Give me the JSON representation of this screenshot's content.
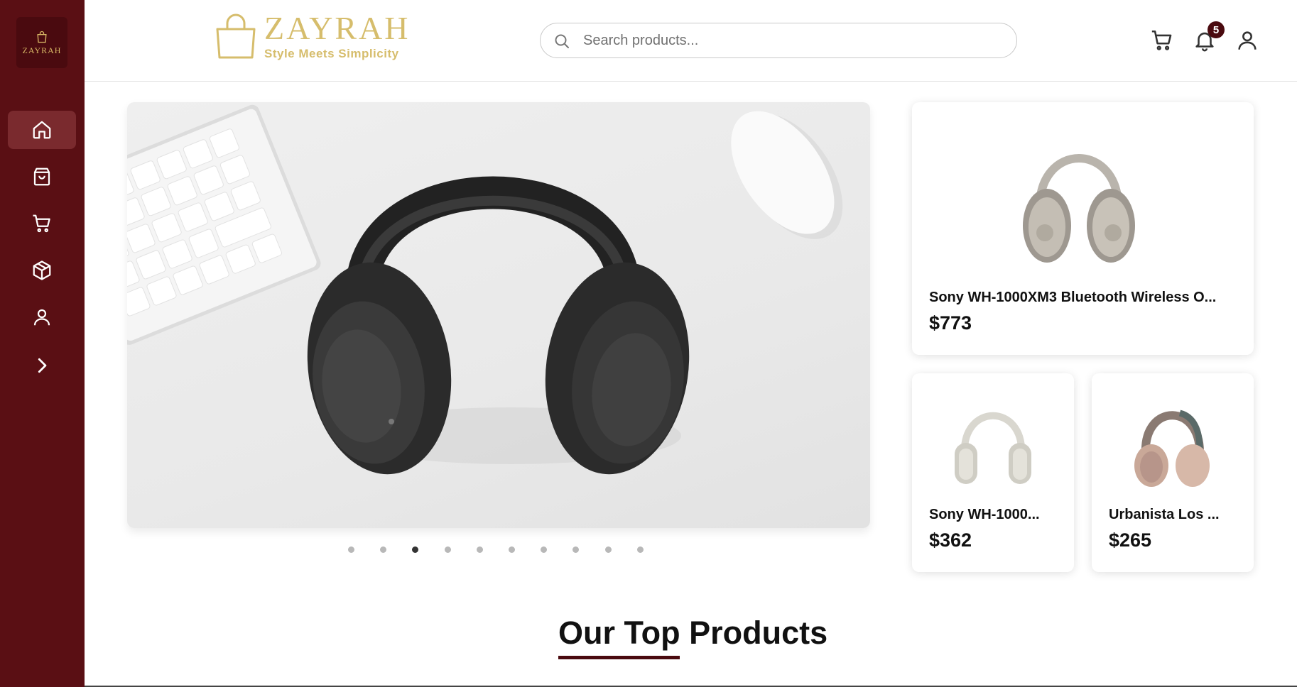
{
  "sidebar": {
    "logo_text": "ZAYRAH",
    "items": [
      {
        "name": "home",
        "icon": "home-icon",
        "active": true
      },
      {
        "name": "shop",
        "icon": "shopping-bag-icon",
        "active": false
      },
      {
        "name": "cart",
        "icon": "cart-icon",
        "active": false
      },
      {
        "name": "products",
        "icon": "box-icon",
        "active": false
      },
      {
        "name": "profile",
        "icon": "user-icon",
        "active": false
      },
      {
        "name": "expand",
        "icon": "chevron-right-icon",
        "active": false
      }
    ]
  },
  "header": {
    "brand_name": "ZAYRAH",
    "brand_tagline": "Style Meets Simplicity",
    "search_placeholder": "Search products...",
    "notification_count": "5"
  },
  "hero": {
    "carousel_total": 10,
    "carousel_active_index": 2
  },
  "products": [
    {
      "name": "Sony WH-1000XM3 Bluetooth Wireless O...",
      "price": "$773"
    },
    {
      "name": "Sony WH-1000...",
      "price": "$362"
    },
    {
      "name": "Urbanista Los ...",
      "price": "$265"
    }
  ],
  "section": {
    "title": "Our Top Products"
  },
  "colors": {
    "sidebar_bg": "#5a0f14",
    "brand_gold": "#d6bd6c",
    "accent_dark": "#4a0a0f"
  }
}
